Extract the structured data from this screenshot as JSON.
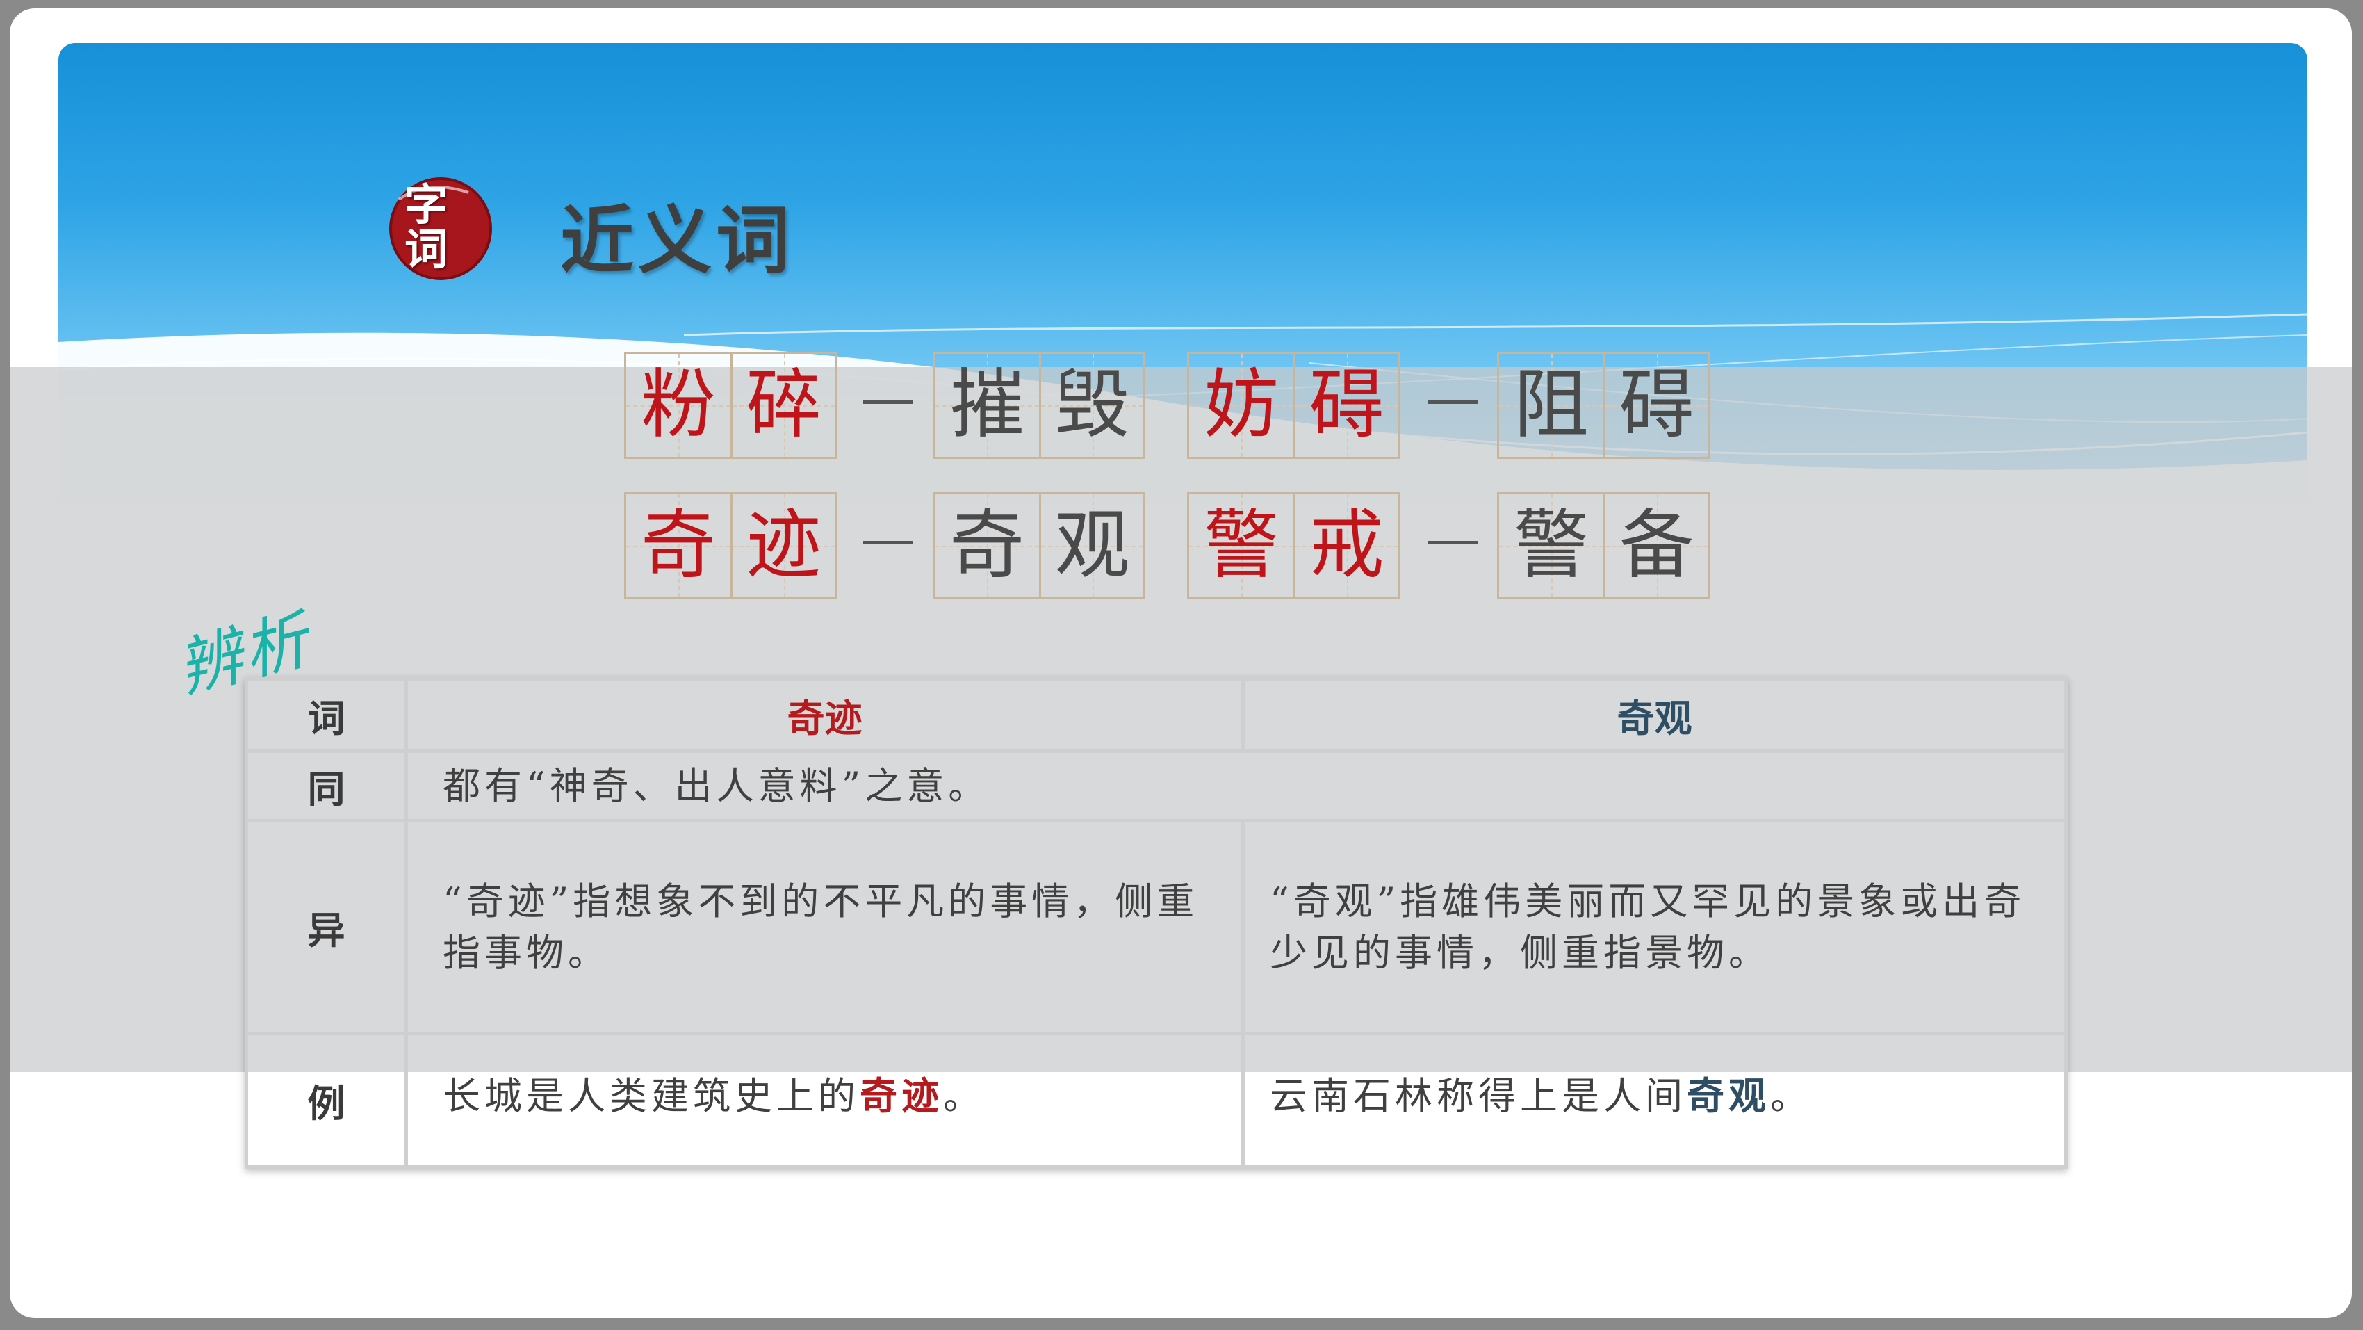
{
  "header": {
    "badge_text": "字词",
    "title": "近义词"
  },
  "word_pairs": {
    "row1": [
      {
        "word": [
          "粉",
          "碎"
        ],
        "synonym": [
          "摧",
          "毁"
        ]
      },
      {
        "word": [
          "妨",
          "碍"
        ],
        "synonym": [
          "阻",
          "碍"
        ]
      }
    ],
    "row2": [
      {
        "word": [
          "奇",
          "迹"
        ],
        "synonym": [
          "奇",
          "观"
        ]
      },
      {
        "word": [
          "警",
          "戒"
        ],
        "synonym": [
          "警",
          "备"
        ]
      }
    ]
  },
  "analysis_label": "辨析",
  "table": {
    "header": {
      "label": "词",
      "word_a": "奇迹",
      "word_b": "奇观"
    },
    "same": {
      "label": "同",
      "text": "都有“神奇、出人意料”之意。"
    },
    "diff": {
      "label": "异",
      "text_a": "“奇迹”指想象不到的不平凡的事情，侧重指事物。",
      "text_b": "“奇观”指雄伟美丽而又罕见的景象或出奇少见的事情，侧重指景物。"
    },
    "example": {
      "label": "例",
      "a_before": "长城是人类建筑史上的",
      "a_highlight": "奇迹",
      "a_after": "。",
      "b_before": "云南石林称得上是人间",
      "b_highlight": "奇观",
      "b_after": "。"
    }
  },
  "colors": {
    "accent_red": "#c0141b",
    "accent_blue": "#2e4e66",
    "brush_teal": "#1bb3a9",
    "banner_blue": "#1790d8"
  }
}
